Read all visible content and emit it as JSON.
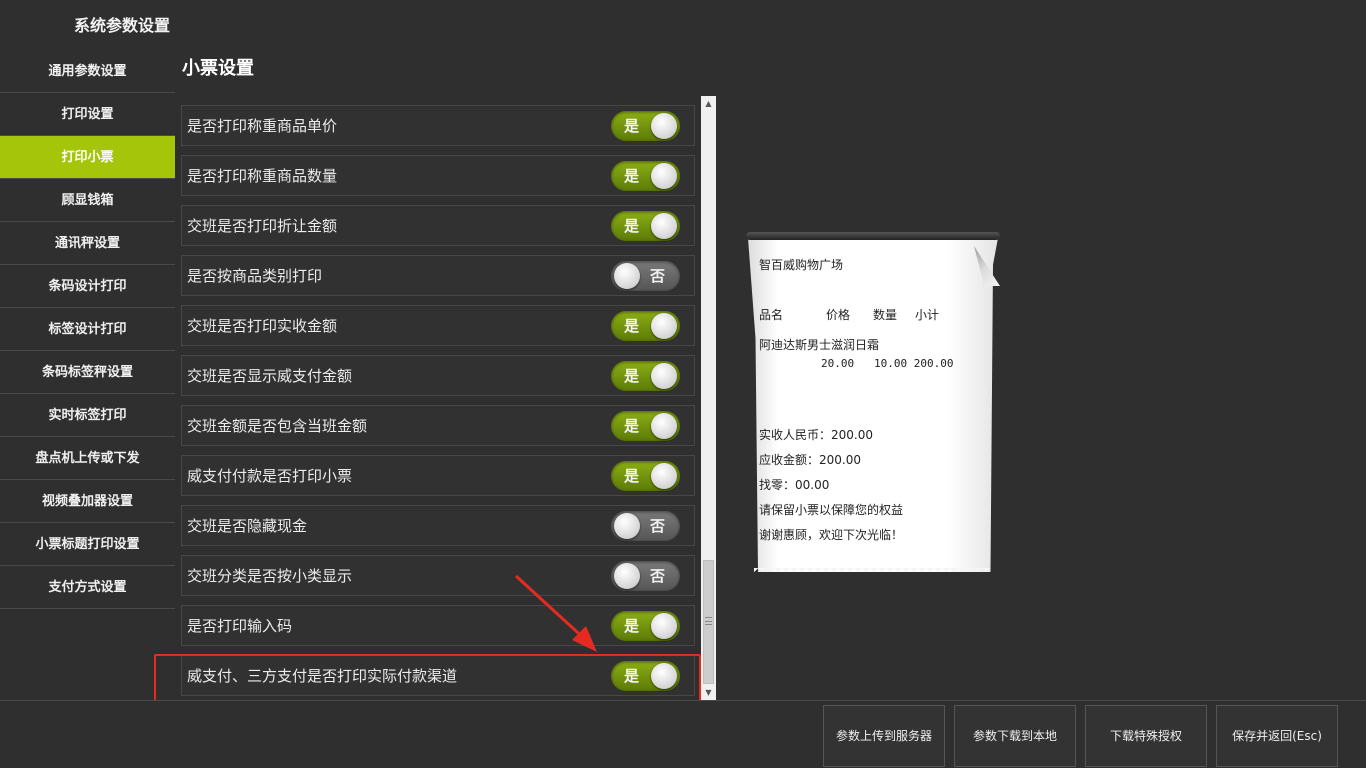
{
  "app": {
    "title": "系统参数设置"
  },
  "sidebar": {
    "items": [
      {
        "label": "通用参数设置",
        "active": false
      },
      {
        "label": "打印设置",
        "active": false
      },
      {
        "label": "打印小票",
        "active": true
      },
      {
        "label": "顾显钱箱",
        "active": false
      },
      {
        "label": "通讯秤设置",
        "active": false
      },
      {
        "label": "条码设计打印",
        "active": false
      },
      {
        "label": "标签设计打印",
        "active": false
      },
      {
        "label": "条码标签秤设置",
        "active": false
      },
      {
        "label": "实时标签打印",
        "active": false
      },
      {
        "label": "盘点机上传或下发",
        "active": false
      },
      {
        "label": "视频叠加器设置",
        "active": false
      },
      {
        "label": "小票标题打印设置",
        "active": false
      },
      {
        "label": "支付方式设置",
        "active": false
      }
    ]
  },
  "main": {
    "title": "小票设置",
    "settings": [
      {
        "label": "是否打印称重商品单价",
        "value": "是",
        "on": true
      },
      {
        "label": "是否打印称重商品数量",
        "value": "是",
        "on": true
      },
      {
        "label": "交班是否打印折让金额",
        "value": "是",
        "on": true
      },
      {
        "label": "是否按商品类别打印",
        "value": "否",
        "on": false
      },
      {
        "label": "交班是否打印实收金额",
        "value": "是",
        "on": true
      },
      {
        "label": "交班是否显示威支付金额",
        "value": "是",
        "on": true
      },
      {
        "label": "交班金额是否包含当班金额",
        "value": "是",
        "on": true
      },
      {
        "label": "威支付付款是否打印小票",
        "value": "是",
        "on": true
      },
      {
        "label": "交班是否隐藏现金",
        "value": "否",
        "on": false
      },
      {
        "label": "交班分类是否按小类显示",
        "value": "否",
        "on": false
      },
      {
        "label": "是否打印输入码",
        "value": "是",
        "on": true
      },
      {
        "label": "威支付、三方支付是否打印实际付款渠道",
        "value": "是",
        "on": true
      }
    ]
  },
  "receipt": {
    "store": "智百威购物广场",
    "header": {
      "name": "品名",
      "price": "价格",
      "qty": "数量",
      "subtotal": "小计"
    },
    "item_name": "阿迪达斯男士滋润日霜",
    "item_values": "20.00   10.00 200.00",
    "received": "实收人民币：200.00",
    "due": "应收金额：200.00",
    "change": "找零：00.00",
    "note1": "请保留小票以保障您的权益",
    "note2": "谢谢惠顾，欢迎下次光临！"
  },
  "footer": {
    "upload": "参数上传到服务器",
    "download": "参数下载到本地",
    "auth": "下载特殊授权",
    "save": "保存并返回(Esc)"
  },
  "colors": {
    "accent": "#a5c50b",
    "toggle_on": "#7a9c10",
    "highlight": "#e52b21"
  }
}
